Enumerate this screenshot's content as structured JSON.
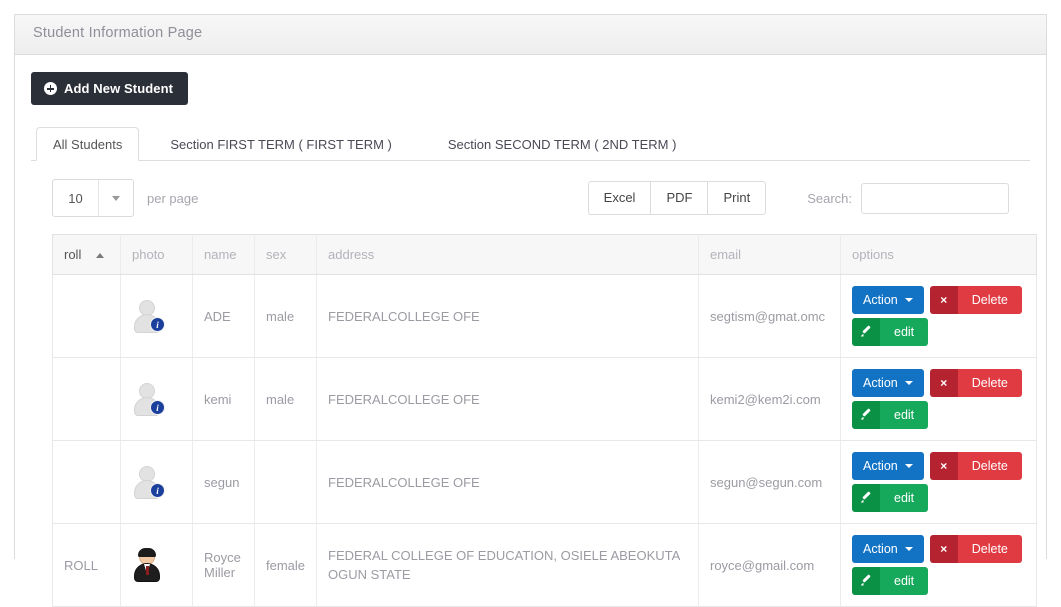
{
  "panel": {
    "title": "Student Information Page"
  },
  "toolbar": {
    "add_label": "Add New Student",
    "add_icon": "plus-circle-icon"
  },
  "tabs": [
    {
      "label": "All Students",
      "active": true
    },
    {
      "label": "Section FIRST TERM ( FIRST TERM )",
      "active": false
    },
    {
      "label": "Section SECOND TERM ( 2ND TERM )",
      "active": false
    }
  ],
  "table_controls": {
    "page_length": "10",
    "page_length_suffix": "per page",
    "page_length_caret": "chevron-down-icon",
    "export": [
      {
        "label": "Excel"
      },
      {
        "label": "PDF"
      },
      {
        "label": "Print"
      }
    ],
    "search_label": "Search:",
    "search_value": "",
    "search_placeholder": ""
  },
  "table": {
    "columns": [
      {
        "key": "roll",
        "label": "roll",
        "sorted": true,
        "sort_dir": "asc"
      },
      {
        "key": "photo",
        "label": "photo",
        "sorted": false
      },
      {
        "key": "name",
        "label": "name",
        "sorted": false
      },
      {
        "key": "sex",
        "label": "sex",
        "sorted": false
      },
      {
        "key": "address",
        "label": "address",
        "sorted": false
      },
      {
        "key": "email",
        "label": "email",
        "sorted": false
      },
      {
        "key": "options",
        "label": "options",
        "sorted": false
      }
    ],
    "rows": [
      {
        "roll": "",
        "photo": "placeholder-user-icon",
        "name": "ADE",
        "sex": "male",
        "address": "FEDERALCOLLEGE OFE",
        "email": "segtism@gmat.omc"
      },
      {
        "roll": "",
        "photo": "placeholder-user-icon",
        "name": "kemi",
        "sex": "male",
        "address": "FEDERALCOLLEGE OFE",
        "email": "kemi2@kem2i.com"
      },
      {
        "roll": "",
        "photo": "placeholder-user-icon",
        "name": "segun",
        "sex": "",
        "address": "FEDERALCOLLEGE OFE",
        "email": "segun@segun.com"
      },
      {
        "roll": "ROLL",
        "photo": "student-photo",
        "name": "Royce Miller",
        "sex": "female",
        "address": "FEDERAL COLLEGE OF EDUCATION, OSIELE ABEOKUTA OGUN STATE",
        "email": "royce@gmail.com"
      }
    ],
    "row_actions": {
      "action_label": "Action",
      "action_caret": "caret-down-icon",
      "delete_label": "Delete",
      "delete_icon": "x-icon",
      "delete_icon_glyph": "×",
      "edit_label": "edit",
      "edit_icon": "pencil-icon"
    }
  },
  "colors": {
    "add_button": "#2b2f38",
    "action_blue": "#1273c4",
    "delete_red": "#e03a42",
    "delete_red_dark": "#b52330",
    "edit_green": "#16a85b",
    "edit_green_dark": "#0b9146"
  }
}
